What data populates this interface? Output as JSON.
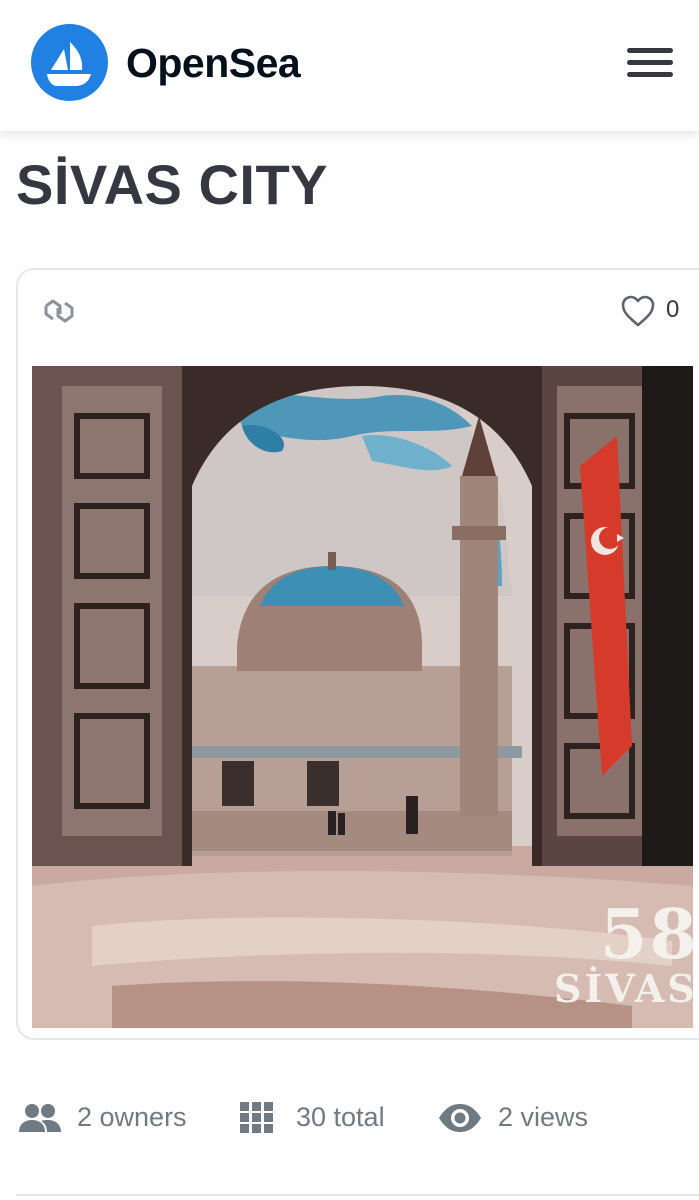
{
  "header": {
    "brand": "OpenSea",
    "logo_icon": "opensea-sailboat-icon",
    "menu_icon": "hamburger-menu-icon",
    "accent_color": "#2081e2"
  },
  "collection": {
    "title": "SİVAS CITY"
  },
  "card": {
    "chain_icon": "polygon-chain-icon",
    "favorite_icon": "heart-outline-icon",
    "favorite_count": "0",
    "artwork": {
      "description_icon": "mosque-through-archway-painting",
      "stamp_number": "58",
      "stamp_city": "SİVAS"
    }
  },
  "stats": {
    "owners": {
      "icon": "people-icon",
      "label": "2 owners"
    },
    "total": {
      "icon": "grid-icon",
      "label": "30 total"
    },
    "views": {
      "icon": "eye-icon",
      "label": "2 views"
    }
  }
}
